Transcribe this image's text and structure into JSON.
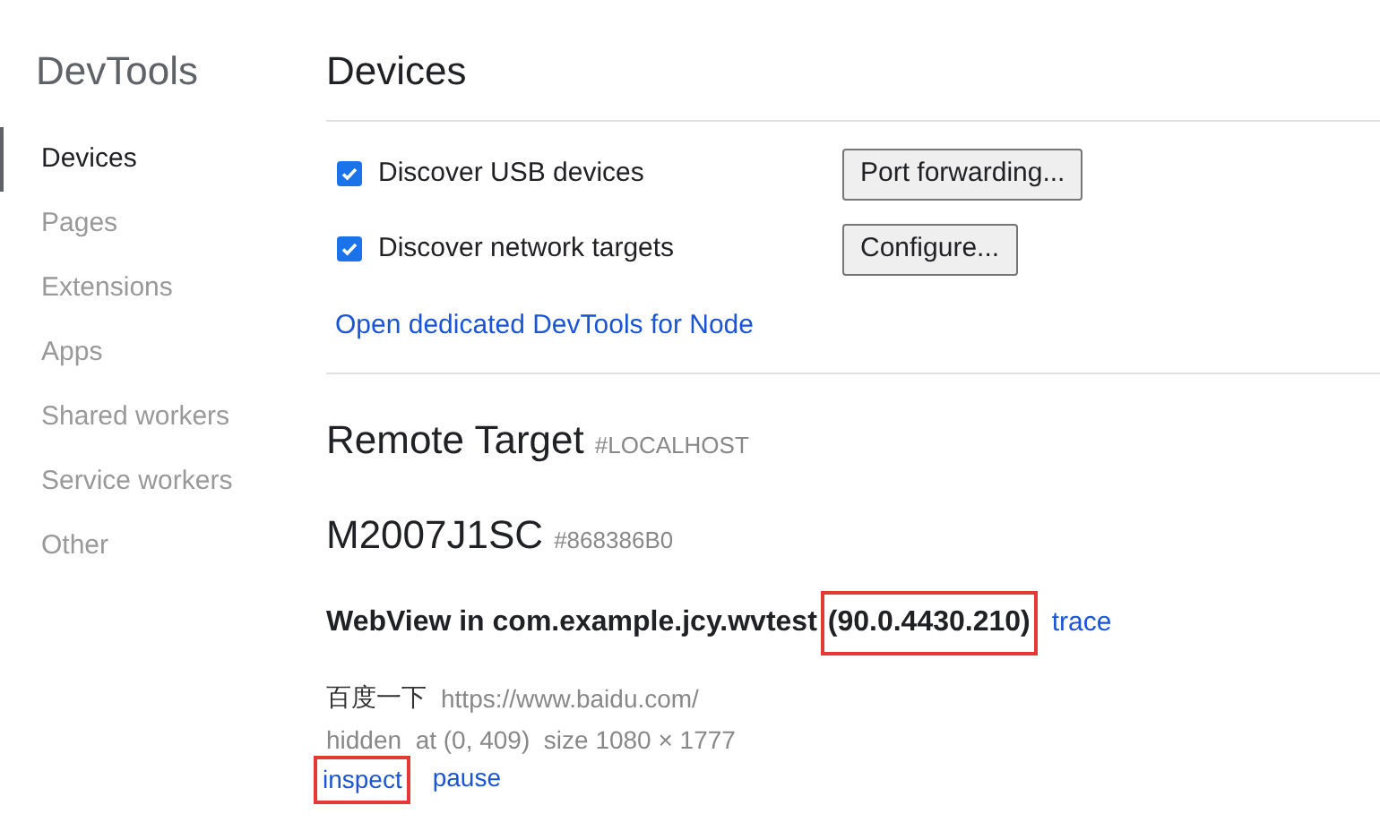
{
  "sidebar": {
    "title": "DevTools",
    "items": [
      {
        "label": "Devices",
        "selected": true
      },
      {
        "label": "Pages",
        "selected": false
      },
      {
        "label": "Extensions",
        "selected": false
      },
      {
        "label": "Apps",
        "selected": false
      },
      {
        "label": "Shared workers",
        "selected": false
      },
      {
        "label": "Service workers",
        "selected": false
      },
      {
        "label": "Other",
        "selected": false
      }
    ]
  },
  "main": {
    "title": "Devices",
    "options": [
      {
        "label": "Discover USB devices",
        "checked": true,
        "button": "Port forwarding..."
      },
      {
        "label": "Discover network targets",
        "checked": true,
        "button": "Configure..."
      }
    ],
    "node_link": "Open dedicated DevTools for Node",
    "remote_target": {
      "title": "Remote Target",
      "tag": "#LOCALHOST"
    },
    "device": {
      "name": "M2007J1SC",
      "serial": "#868386B0"
    },
    "browser": {
      "name": "WebView in com.example.jcy.wvtest",
      "version": "(90.0.4430.210)",
      "version_highlighted": true,
      "action": "trace"
    },
    "target": {
      "title": "百度一下",
      "url": "https://www.baidu.com/",
      "details": "hidden  at (0, 409)  size 1080 × 1777",
      "actions": [
        {
          "label": "inspect",
          "highlighted": true
        },
        {
          "label": "pause",
          "highlighted": false
        }
      ]
    }
  }
}
